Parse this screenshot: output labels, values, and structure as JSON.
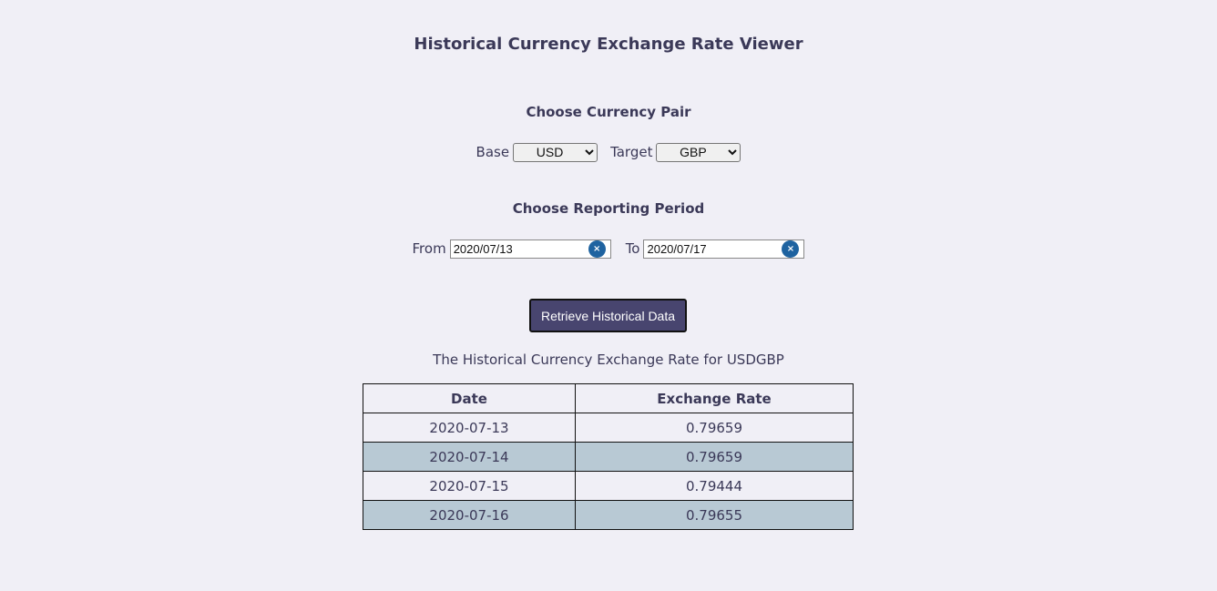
{
  "title": "Historical Currency Exchange Rate Viewer",
  "pair_section": {
    "heading": "Choose Currency Pair",
    "base_label": "Base",
    "base_value": "USD",
    "target_label": "Target",
    "target_value": "GBP"
  },
  "period_section": {
    "heading": "Choose Reporting Period",
    "from_label": "From",
    "from_value": "2020/07/13",
    "to_label": "To",
    "to_value": "2020/07/17",
    "clear_glyph": "×"
  },
  "retrieve_button": "Retrieve Historical Data",
  "result_caption": "The Historical Currency Exchange Rate for USDGBP",
  "table": {
    "headers": [
      "Date",
      "Exchange Rate"
    ],
    "rows": [
      {
        "date": "2020-07-13",
        "rate": "0.79659"
      },
      {
        "date": "2020-07-14",
        "rate": "0.79659"
      },
      {
        "date": "2020-07-15",
        "rate": "0.79444"
      },
      {
        "date": "2020-07-16",
        "rate": "0.79655"
      }
    ]
  },
  "colors": {
    "background": "#f0eff6",
    "text": "#3b3958",
    "button": "#48456f",
    "alt_row": "#b8c9d4",
    "clear_icon": "#1f63a0"
  }
}
